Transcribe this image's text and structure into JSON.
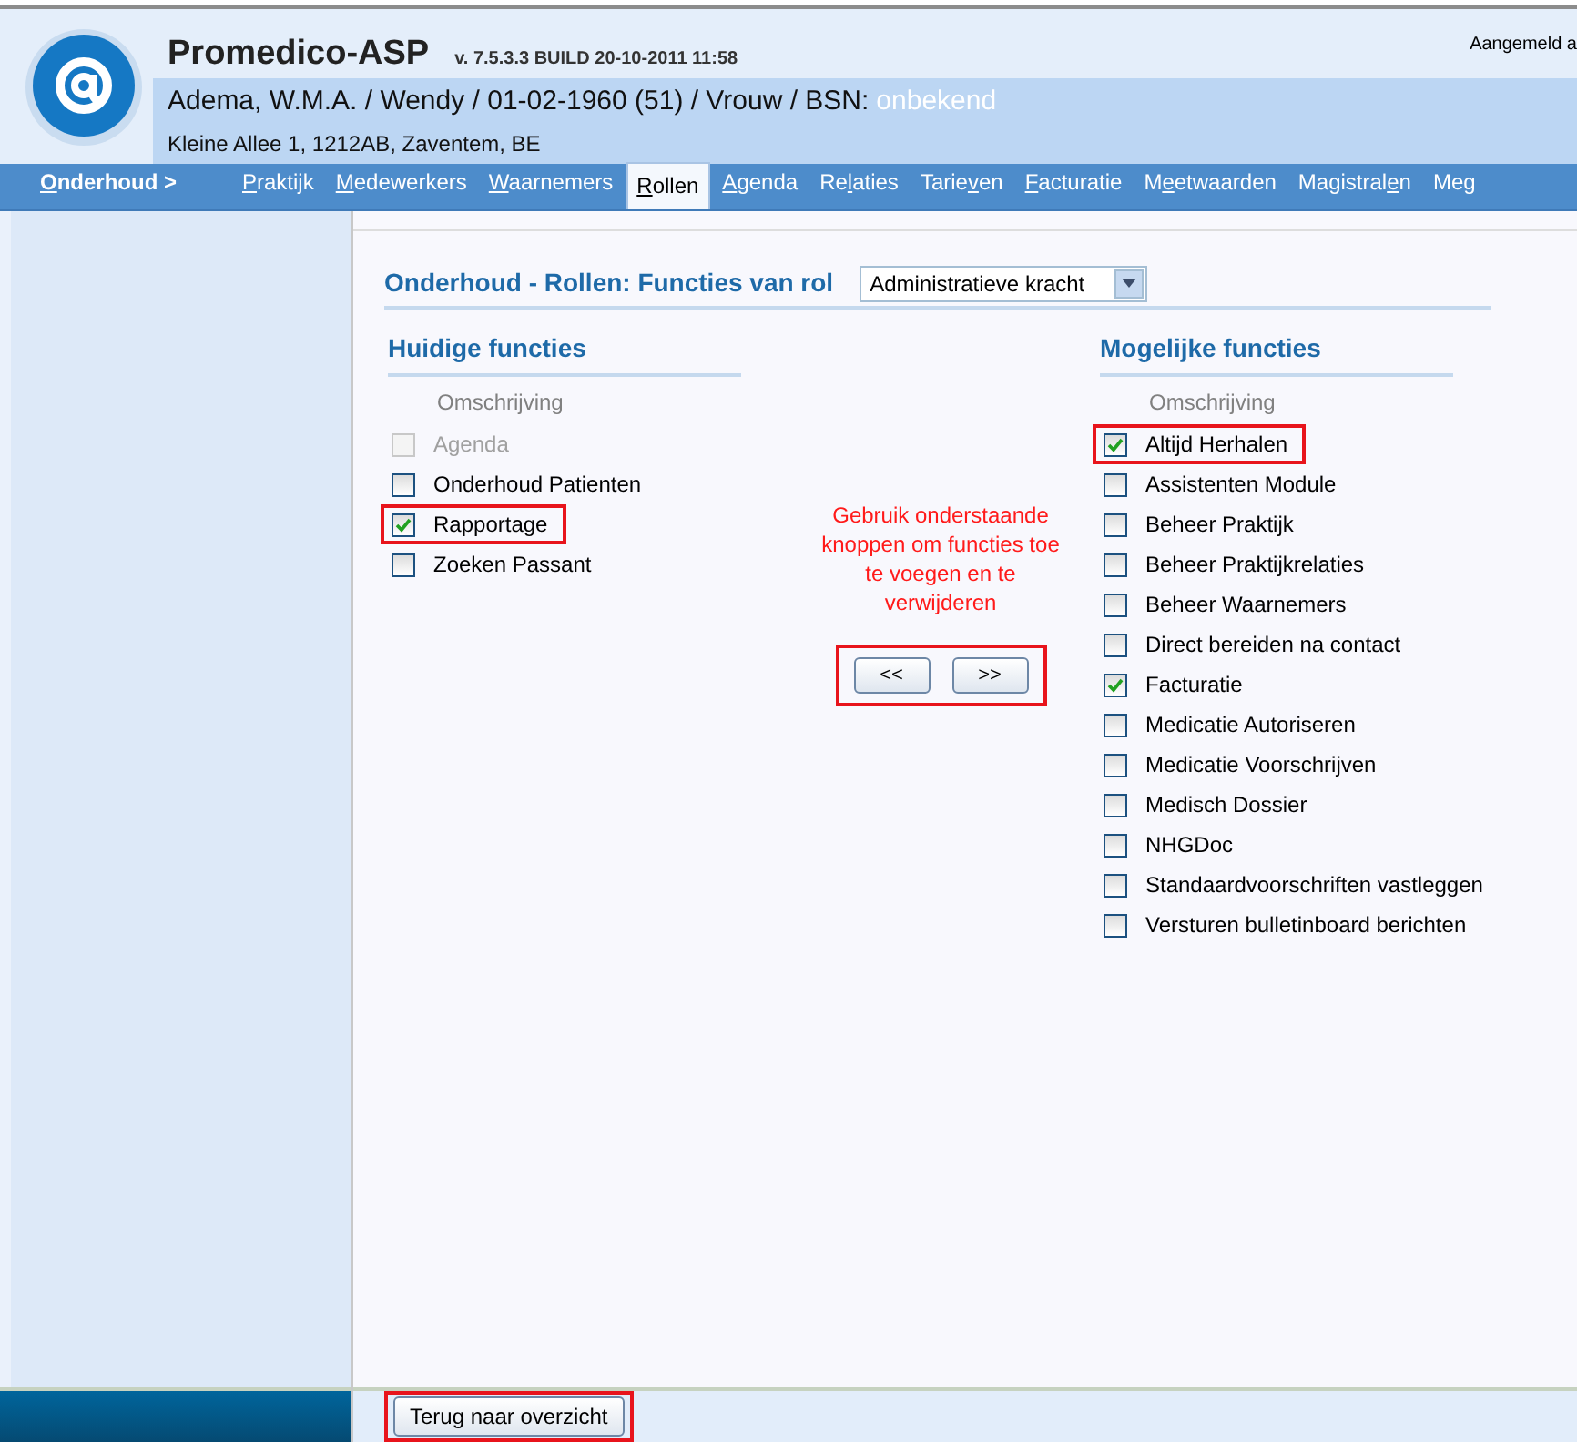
{
  "header": {
    "title": "Promedico-ASP",
    "version": "v. 7.5.3.3 BUILD 20-10-2011 11:58",
    "login": "Aangemeld a",
    "patient": "Adema, W.M.A. / Wendy / 01-02-1960 (51) / Vrouw / BSN:",
    "bsn": "onbekend",
    "address": "Kleine Allee 1, 1212AB, Zaventem, BE"
  },
  "nav": {
    "section": {
      "key": "O",
      "after": "nderhoud >"
    },
    "items": [
      {
        "key": "P",
        "after": "raktijk",
        "selected": false
      },
      {
        "key": "M",
        "after": "edewerkers",
        "selected": false
      },
      {
        "key": "W",
        "after": "aarnemers",
        "selected": false
      },
      {
        "key": "R",
        "after": "ollen",
        "selected": true
      },
      {
        "key": "A",
        "after": "genda",
        "selected": false
      },
      {
        "before": "Re",
        "key": "l",
        "after": "aties",
        "selected": false
      },
      {
        "before": "Tarie",
        "key": "v",
        "after": "en",
        "selected": false
      },
      {
        "key": "F",
        "after": "acturatie",
        "selected": false
      },
      {
        "before": "M",
        "key": "e",
        "after": "etwaarden",
        "selected": false
      },
      {
        "before": "Magistral",
        "key": "e",
        "after": "n",
        "selected": false
      },
      {
        "before": "Meg",
        "selected": false
      }
    ]
  },
  "page": {
    "title": "Onderhoud - Rollen: Functies van rol",
    "role_select": "Administratieve kracht"
  },
  "current": {
    "heading": "Huidige functies",
    "column": "Omschrijving",
    "items": [
      {
        "label": "Agenda",
        "checked": false,
        "disabled": true,
        "highlighted": false
      },
      {
        "label": "Onderhoud Patienten",
        "checked": false,
        "disabled": false,
        "highlighted": false
      },
      {
        "label": "Rapportage",
        "checked": true,
        "disabled": false,
        "highlighted": true
      },
      {
        "label": "Zoeken Passant",
        "checked": false,
        "disabled": false,
        "highlighted": false
      }
    ]
  },
  "hint": "Gebruik onderstaande knoppen om functies toe te voegen en te verwijderen",
  "move_buttons": [
    "<<",
    ">>"
  ],
  "possible": {
    "heading": "Mogelijke functies",
    "column": "Omschrijving",
    "items": [
      {
        "label": "Altijd Herhalen",
        "checked": true,
        "disabled": false,
        "highlighted": true
      },
      {
        "label": "Assistenten Module",
        "checked": false,
        "disabled": false,
        "highlighted": false
      },
      {
        "label": "Beheer Praktijk",
        "checked": false,
        "disabled": false,
        "highlighted": false
      },
      {
        "label": "Beheer Praktijkrelaties",
        "checked": false,
        "disabled": false,
        "highlighted": false
      },
      {
        "label": "Beheer Waarnemers",
        "checked": false,
        "disabled": false,
        "highlighted": false
      },
      {
        "label": "Direct bereiden na contact",
        "checked": false,
        "disabled": false,
        "highlighted": false
      },
      {
        "label": "Facturatie",
        "checked": true,
        "disabled": false,
        "highlighted": false
      },
      {
        "label": "Medicatie Autoriseren",
        "checked": false,
        "disabled": false,
        "highlighted": false
      },
      {
        "label": "Medicatie Voorschrijven",
        "checked": false,
        "disabled": false,
        "highlighted": false
      },
      {
        "label": "Medisch Dossier",
        "checked": false,
        "disabled": false,
        "highlighted": false
      },
      {
        "label": "NHGDoc",
        "checked": false,
        "disabled": false,
        "highlighted": false
      },
      {
        "label": "Standaardvoorschriften vastleggen",
        "checked": false,
        "disabled": false,
        "highlighted": false
      },
      {
        "label": "Versturen bulletinboard berichten",
        "checked": false,
        "disabled": false,
        "highlighted": false
      }
    ]
  },
  "footer": {
    "back_button": "Terug naar overzicht"
  }
}
